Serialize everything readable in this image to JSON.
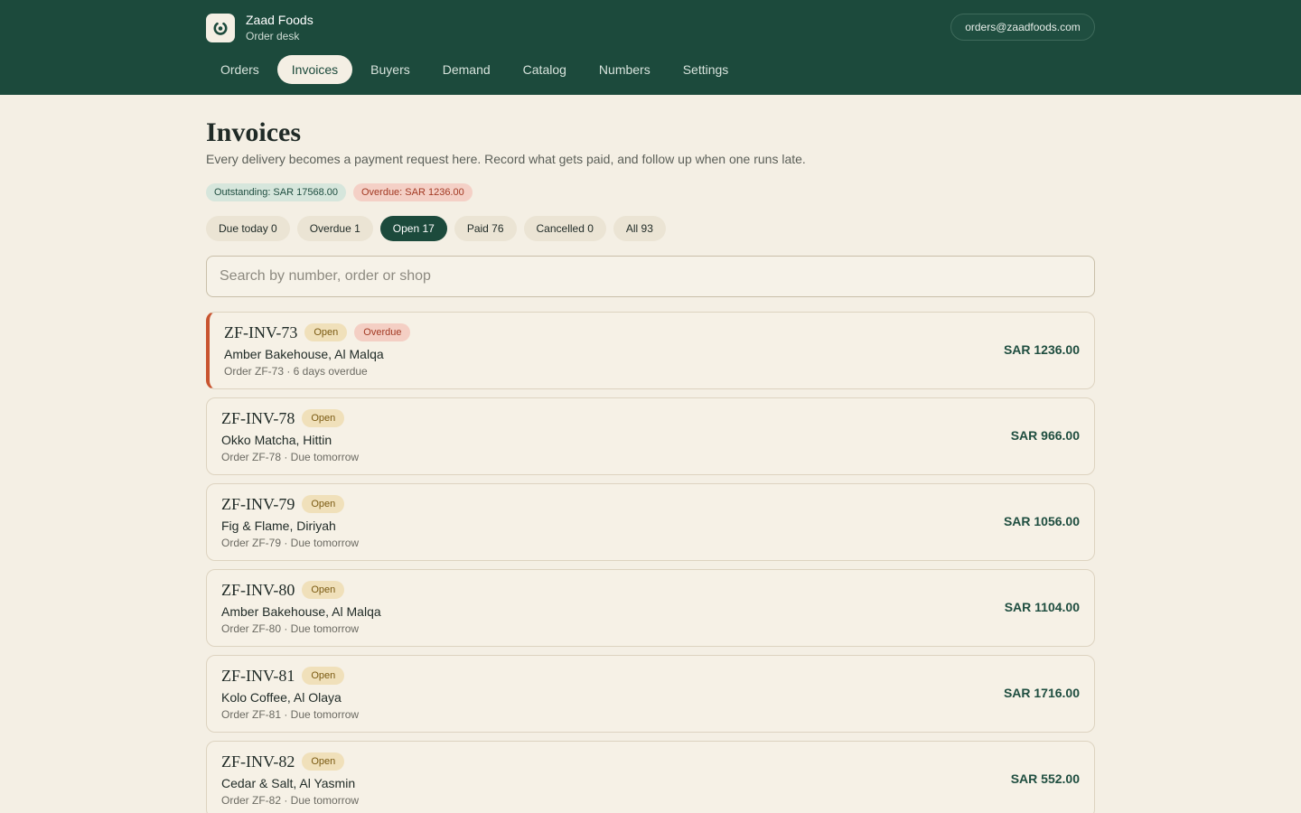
{
  "brand": {
    "name": "Zaad Foods",
    "subtitle": "Order desk"
  },
  "account": {
    "email": "orders@zaadfoods.com"
  },
  "nav": {
    "tabs": [
      {
        "label": "Orders",
        "active": false
      },
      {
        "label": "Invoices",
        "active": true
      },
      {
        "label": "Buyers",
        "active": false
      },
      {
        "label": "Demand",
        "active": false
      },
      {
        "label": "Catalog",
        "active": false
      },
      {
        "label": "Numbers",
        "active": false
      },
      {
        "label": "Settings",
        "active": false
      }
    ]
  },
  "page": {
    "title": "Invoices",
    "description": "Every delivery becomes a payment request here. Record what gets paid, and follow up when one runs late."
  },
  "summary": {
    "outstanding": "Outstanding: SAR 17568.00",
    "overdue": "Overdue: SAR 1236.00"
  },
  "filters": [
    {
      "label": "Due today 0",
      "active": false
    },
    {
      "label": "Overdue 1",
      "active": false
    },
    {
      "label": "Open 17",
      "active": true
    },
    {
      "label": "Paid 76",
      "active": false
    },
    {
      "label": "Cancelled 0",
      "active": false
    },
    {
      "label": "All 93",
      "active": false
    }
  ],
  "search": {
    "placeholder": "Search by number, order or shop",
    "value": ""
  },
  "invoices": [
    {
      "number": "ZF-INV-73",
      "status": "Open",
      "flag": "Overdue",
      "shop": "Amber Bakehouse, Al Malqa",
      "meta": "Order ZF-73 · 6 days overdue",
      "amount": "SAR 1236.00"
    },
    {
      "number": "ZF-INV-78",
      "status": "Open",
      "flag": "",
      "shop": "Okko Matcha, Hittin",
      "meta": "Order ZF-78 · Due tomorrow",
      "amount": "SAR 966.00"
    },
    {
      "number": "ZF-INV-79",
      "status": "Open",
      "flag": "",
      "shop": "Fig & Flame, Diriyah",
      "meta": "Order ZF-79 · Due tomorrow",
      "amount": "SAR 1056.00"
    },
    {
      "number": "ZF-INV-80",
      "status": "Open",
      "flag": "",
      "shop": "Amber Bakehouse, Al Malqa",
      "meta": "Order ZF-80 · Due tomorrow",
      "amount": "SAR 1104.00"
    },
    {
      "number": "ZF-INV-81",
      "status": "Open",
      "flag": "",
      "shop": "Kolo Coffee, Al Olaya",
      "meta": "Order ZF-81 · Due tomorrow",
      "amount": "SAR 1716.00"
    },
    {
      "number": "ZF-INV-82",
      "status": "Open",
      "flag": "",
      "shop": "Cedar & Salt, Al Yasmin",
      "meta": "Order ZF-82 · Due tomorrow",
      "amount": "SAR 552.00"
    }
  ],
  "colors": {
    "brand_green": "#1c4a3c",
    "background": "#f4efe4",
    "overdue_accent": "#c8542f"
  },
  "icons": {
    "logo": "power-ring-icon"
  }
}
